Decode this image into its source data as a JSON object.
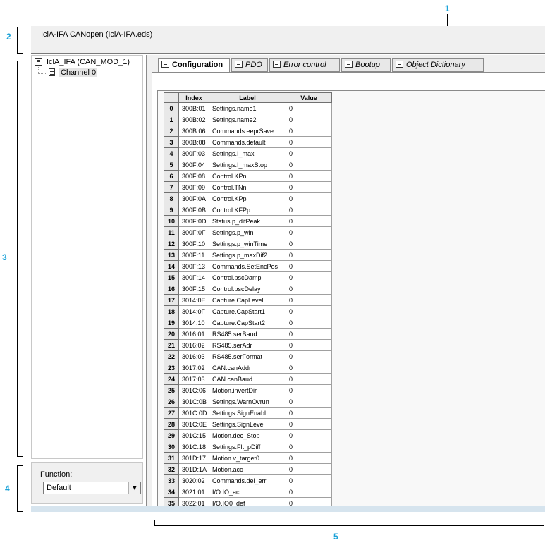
{
  "callouts": {
    "c1": "1",
    "c2": "2",
    "c3": "3",
    "c4": "4",
    "c5": "5"
  },
  "window": {
    "title": "IclA-IFA CANopen (IclA-IFA.eds)"
  },
  "tree": {
    "root": "IclA_IFA (CAN_MOD_1)",
    "root_icon": "module-icon",
    "child": "Channel 0",
    "child_icon": "document-icon"
  },
  "function": {
    "label": "Function:",
    "value": "Default"
  },
  "tabs": [
    {
      "label": "Configuration"
    },
    {
      "label": "PDO"
    },
    {
      "label": "Error control"
    },
    {
      "label": "Bootup"
    },
    {
      "label": "Object Dictionary"
    }
  ],
  "grid": {
    "headers": [
      "Index",
      "Label",
      "Value"
    ],
    "rows": [
      [
        "0",
        "300B:01",
        "Settings.name1",
        "0"
      ],
      [
        "1",
        "300B:02",
        "Settings.name2",
        "0"
      ],
      [
        "2",
        "300B:06",
        "Commands.eeprSave",
        "0"
      ],
      [
        "3",
        "300B:08",
        "Commands.default",
        "0"
      ],
      [
        "4",
        "300F:03",
        "Settings.I_max",
        "0"
      ],
      [
        "5",
        "300F:04",
        "Settings.I_maxStop",
        "0"
      ],
      [
        "6",
        "300F:08",
        "Control.KPn",
        "0"
      ],
      [
        "7",
        "300F:09",
        "Control.TNn",
        "0"
      ],
      [
        "8",
        "300F:0A",
        "Control.KPp",
        "0"
      ],
      [
        "9",
        "300F:0B",
        "Control.KFPp",
        "0"
      ],
      [
        "10",
        "300F:0D",
        "Status.p_difPeak",
        "0"
      ],
      [
        "11",
        "300F:0F",
        "Settings.p_win",
        "0"
      ],
      [
        "12",
        "300F:10",
        "Settings.p_winTime",
        "0"
      ],
      [
        "13",
        "300F:11",
        "Settings.p_maxDif2",
        "0"
      ],
      [
        "14",
        "300F:13",
        "Commands.SetEncPos",
        "0"
      ],
      [
        "15",
        "300F:14",
        "Control.pscDamp",
        "0"
      ],
      [
        "16",
        "300F:15",
        "Control.pscDelay",
        "0"
      ],
      [
        "17",
        "3014:0E",
        "Capture.CapLevel",
        "0"
      ],
      [
        "18",
        "3014:0F",
        "Capture.CapStart1",
        "0"
      ],
      [
        "19",
        "3014:10",
        "Capture.CapStart2",
        "0"
      ],
      [
        "20",
        "3016:01",
        "RS485.serBaud",
        "0"
      ],
      [
        "21",
        "3016:02",
        "RS485.serAdr",
        "0"
      ],
      [
        "22",
        "3016:03",
        "RS485.serFormat",
        "0"
      ],
      [
        "23",
        "3017:02",
        "CAN.canAddr",
        "0"
      ],
      [
        "24",
        "3017:03",
        "CAN.canBaud",
        "0"
      ],
      [
        "25",
        "301C:06",
        "Motion.invertDir",
        "0"
      ],
      [
        "26",
        "301C:0B",
        "Settings.WarnOvrun",
        "0"
      ],
      [
        "27",
        "301C:0D",
        "Settings.SignEnabl",
        "0"
      ],
      [
        "28",
        "301C:0E",
        "Settings.SignLevel",
        "0"
      ],
      [
        "29",
        "301C:15",
        "Motion.dec_Stop",
        "0"
      ],
      [
        "30",
        "301C:18",
        "Settings.Flt_pDiff",
        "0"
      ],
      [
        "31",
        "301D:17",
        "Motion.v_target0",
        "0"
      ],
      [
        "32",
        "301D:1A",
        "Motion.acc",
        "0"
      ],
      [
        "33",
        "3020:02",
        "Commands.del_err",
        "0"
      ],
      [
        "34",
        "3021:01",
        "I/O.IO_act",
        "0"
      ],
      [
        "35",
        "3022:01",
        "I/O.IO0_def",
        "0"
      ]
    ]
  }
}
